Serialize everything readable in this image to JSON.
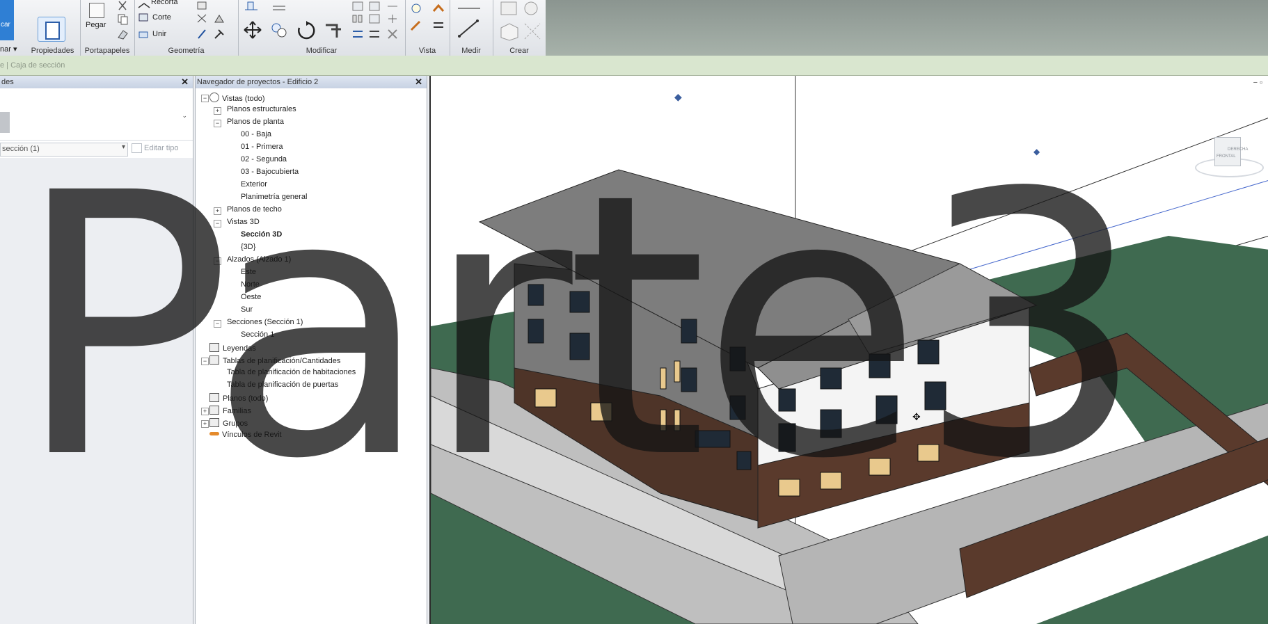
{
  "ribbon": {
    "left_button_label": "car",
    "mode_dropdown": "nar ▾",
    "panels": [
      {
        "label": "Propiedades"
      },
      {
        "label": "Portapapeles"
      },
      {
        "label": "Geometría"
      },
      {
        "label": "Modificar"
      },
      {
        "label": "Vista"
      },
      {
        "label": "Medir"
      },
      {
        "label": "Crear"
      }
    ],
    "clipboard": {
      "paste": "Pegar"
    },
    "geometry": {
      "cope": "Recorta",
      "cut": "Corte",
      "join": "Unir"
    }
  },
  "optionbar": {
    "text": "e | Caja de sección"
  },
  "properties": {
    "title": "des",
    "type_selector": "sección (1)",
    "edit_type": "Editar tipo"
  },
  "browser": {
    "title": "Navegador de proyectos - Edificio 2",
    "items": [
      {
        "label": "Vistas (todo)"
      },
      {
        "label": "Planos estructurales"
      },
      {
        "label": "Planos de planta"
      },
      {
        "label": "00 - Baja"
      },
      {
        "label": "01 - Primera"
      },
      {
        "label": "02 - Segunda"
      },
      {
        "label": "03 - Bajocubierta"
      },
      {
        "label": "Exterior"
      },
      {
        "label": "Planimetría general"
      },
      {
        "label": "Planos de techo"
      },
      {
        "label": "Vistas 3D"
      },
      {
        "label": "Sección 3D"
      },
      {
        "label": "{3D}"
      },
      {
        "label": "Alzados (Alzado 1)"
      },
      {
        "label": "Este"
      },
      {
        "label": "Norte"
      },
      {
        "label": "Oeste"
      },
      {
        "label": "Sur"
      },
      {
        "label": "Secciones (Sección 1)"
      },
      {
        "label": "Sección 1"
      },
      {
        "label": "Leyendas"
      },
      {
        "label": "Tablas de planificación/Cantidades"
      },
      {
        "label": "Tabla de planificación de habitaciones"
      },
      {
        "label": "Tabla de planificación de puertas"
      },
      {
        "label": "Planos (todo)"
      },
      {
        "label": "Familias"
      },
      {
        "label": "Grupos"
      },
      {
        "label": "Vínculos de Revit"
      }
    ]
  },
  "viewcube": {
    "front": "FRONTAL",
    "right": "DERECHA"
  },
  "overlay": {
    "text": "Parte3"
  },
  "colors": {
    "selection_blue": "#2f7fd4",
    "grass": "#3f6a50",
    "brick": "#5a3a2c",
    "roof": "#7d7d7d"
  }
}
